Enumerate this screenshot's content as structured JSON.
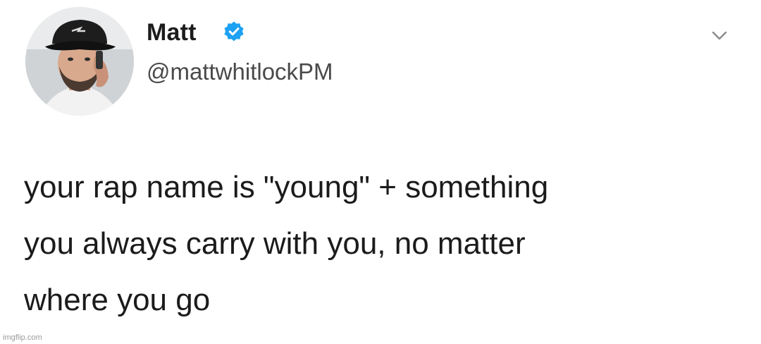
{
  "user": {
    "display_name": "Matt",
    "handle": "@mattwhitlockPM",
    "verified": true,
    "avatar_icon": "profile-photo",
    "badge_color": "#1da1f2"
  },
  "menu": {
    "icon": "chevron-down-icon"
  },
  "tweet": {
    "lines": [
      "your rap name is \"young\" + something",
      "you always carry with you, no matter",
      "where you go"
    ]
  },
  "watermark": {
    "text": "imgflip.com"
  }
}
